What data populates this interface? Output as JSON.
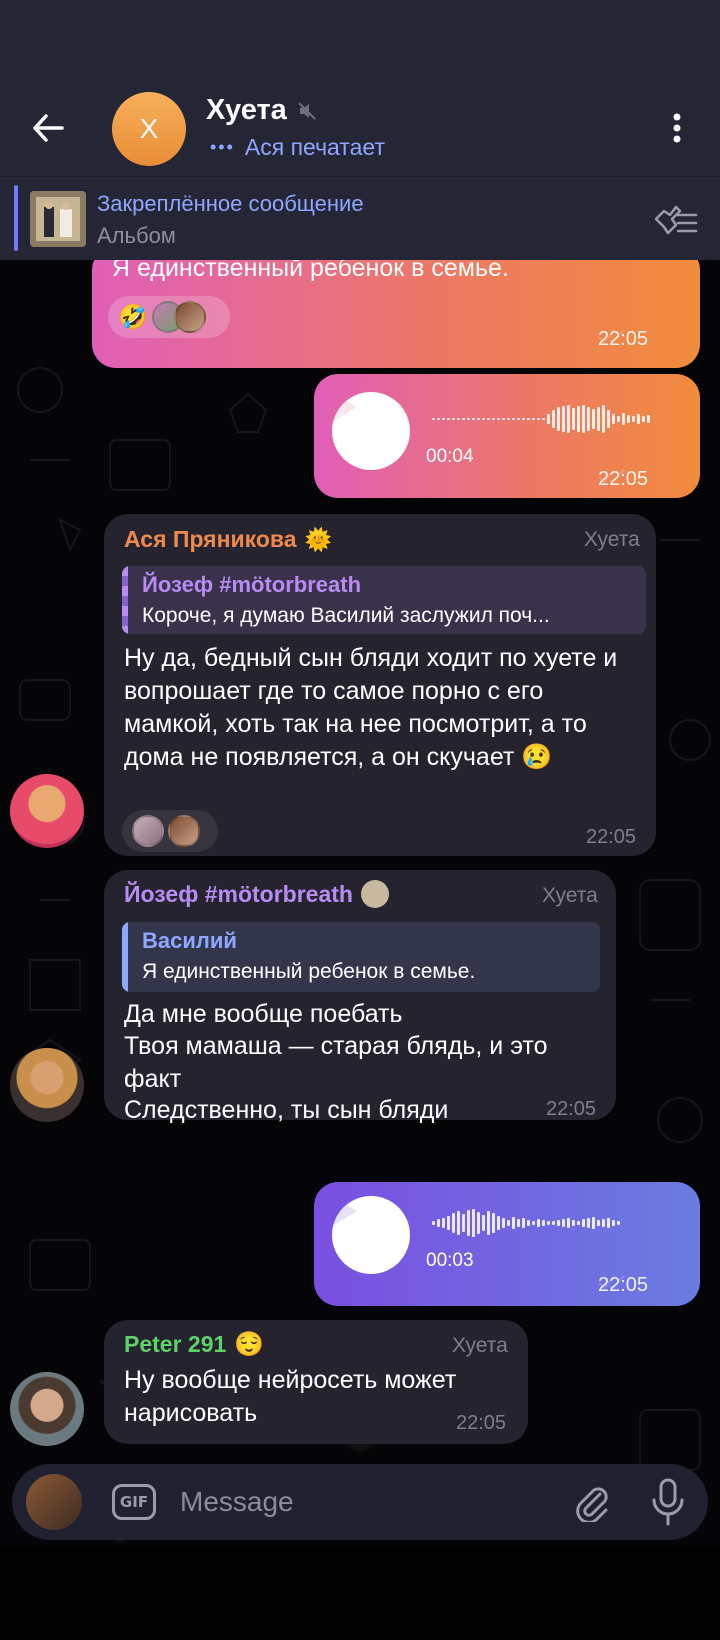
{
  "header": {
    "title": "Хуета",
    "avatar_letter": "Х",
    "status": "Ася печатает",
    "muted": true
  },
  "pinned": {
    "title": "Закреплённое сообщение",
    "subtitle": "Альбом"
  },
  "messages": {
    "m1": {
      "text": "Я единственный ребенок в семье.",
      "time": "22:05",
      "reaction_emoji": "🤣"
    },
    "m2": {
      "duration": "00:04",
      "time": "22:05"
    },
    "m3": {
      "sender": "Ася Пряникова",
      "sender_emoji": "🌞",
      "role": "Хуета",
      "reply_name": "Йозеф #mötorbreath",
      "reply_text": "Короче, я думаю Василий заслужил поч...",
      "text": "Ну да, бедный сын бляди ходит по хуете и вопрошает где то самое порно с его мамкой, хоть так на нее посмотрит, а то дома не появляется, а он скучает 😢",
      "time": "22:05"
    },
    "m4": {
      "sender": "Йозеф #mötorbreath",
      "role": "Хуета",
      "reply_name": "Василий",
      "reply_text": "Я единственный ребенок в семье.",
      "text_line1": "Да мне вообще поебать",
      "text_line2": "Твоя мамаша — старая блядь, и это факт",
      "text_line3": "Следственно, ты сын бляди",
      "time": "22:05"
    },
    "m5": {
      "duration": "00:03",
      "time": "22:05"
    },
    "m6": {
      "sender": "Peter 291",
      "sender_emoji": "😌",
      "role": "Хуета",
      "text": "Ну вообще нейросеть может нарисовать",
      "time": "22:05"
    }
  },
  "input": {
    "placeholder": "Message",
    "gif_label": "GIF"
  },
  "colors": {
    "header_bg": "#242535",
    "accent": "#8fa7ff",
    "sender_asya": "#f0894e",
    "sender_yozef": "#b98cf5",
    "sender_peter": "#5fd06a"
  }
}
